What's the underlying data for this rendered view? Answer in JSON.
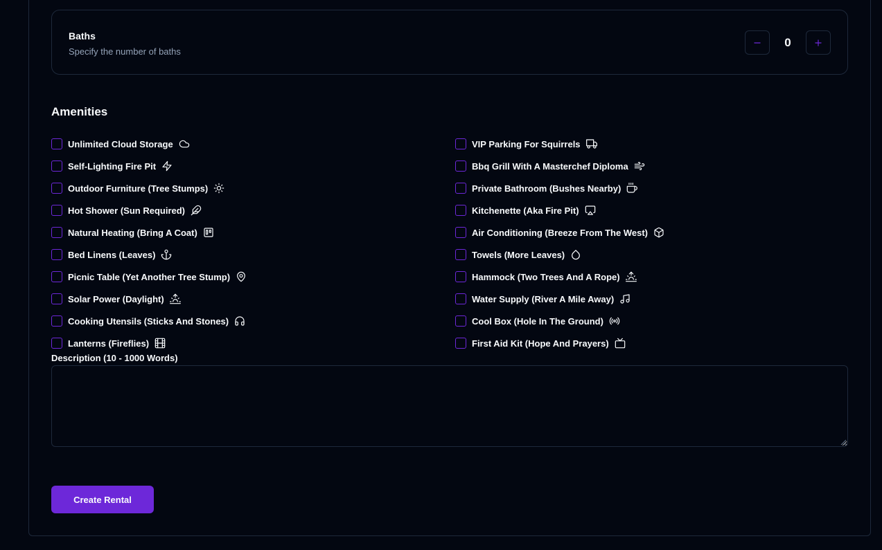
{
  "baths": {
    "title": "Baths",
    "subtitle": "Specify the number of baths",
    "value": "0"
  },
  "amenities": {
    "heading": "Amenities",
    "left": [
      {
        "label": "Unlimited Cloud Storage",
        "icon": "cloud-icon",
        "checked": false
      },
      {
        "label": "Self-Lighting Fire Pit",
        "icon": "zap-icon",
        "checked": false
      },
      {
        "label": "Outdoor Furniture (Tree Stumps)",
        "icon": "sun-icon",
        "checked": false
      },
      {
        "label": "Hot Shower (Sun Required)",
        "icon": "feather-icon",
        "checked": false
      },
      {
        "label": "Natural Heating (Bring A Coat)",
        "icon": "trello-icon",
        "checked": false
      },
      {
        "label": "Bed Linens (Leaves)",
        "icon": "anchor-icon",
        "checked": false
      },
      {
        "label": "Picnic Table (Yet Another Tree Stump)",
        "icon": "map-pin-icon",
        "checked": false
      },
      {
        "label": "Solar Power (Daylight)",
        "icon": "sunrise-icon",
        "checked": false
      },
      {
        "label": "Cooking Utensils (Sticks And Stones)",
        "icon": "headphones-icon",
        "checked": false
      },
      {
        "label": "Lanterns (Fireflies)",
        "icon": "film-icon",
        "checked": false
      }
    ],
    "right": [
      {
        "label": "VIP Parking For Squirrels",
        "icon": "truck-icon",
        "checked": false
      },
      {
        "label": "Bbq Grill With A Masterchef Diploma",
        "icon": "wind-icon",
        "checked": false
      },
      {
        "label": "Private Bathroom (Bushes Nearby)",
        "icon": "coffee-icon",
        "checked": false
      },
      {
        "label": "Kitchenette (Aka Fire Pit)",
        "icon": "airplay-icon",
        "checked": false
      },
      {
        "label": "Air Conditioning (Breeze From The West)",
        "icon": "box-icon",
        "checked": false
      },
      {
        "label": "Towels (More Leaves)",
        "icon": "droplet-icon",
        "checked": false
      },
      {
        "label": "Hammock (Two Trees And A Rope)",
        "icon": "sunrise-icon",
        "checked": false
      },
      {
        "label": "Water Supply (River A Mile Away)",
        "icon": "music-icon",
        "checked": false
      },
      {
        "label": "Cool Box (Hole In The Ground)",
        "icon": "radio-icon",
        "checked": false
      },
      {
        "label": "First Aid Kit (Hope And Prayers)",
        "icon": "tv-icon",
        "checked": false
      }
    ]
  },
  "description": {
    "label": "Description (10 - 1000 Words)",
    "value": "",
    "placeholder": ""
  },
  "submit": {
    "label": "Create Rental"
  },
  "colors": {
    "background": "#030711",
    "border": "#1e293b",
    "accent": "#6d28d9",
    "muted_text": "#94a3b8",
    "text": "#f8fafc"
  }
}
